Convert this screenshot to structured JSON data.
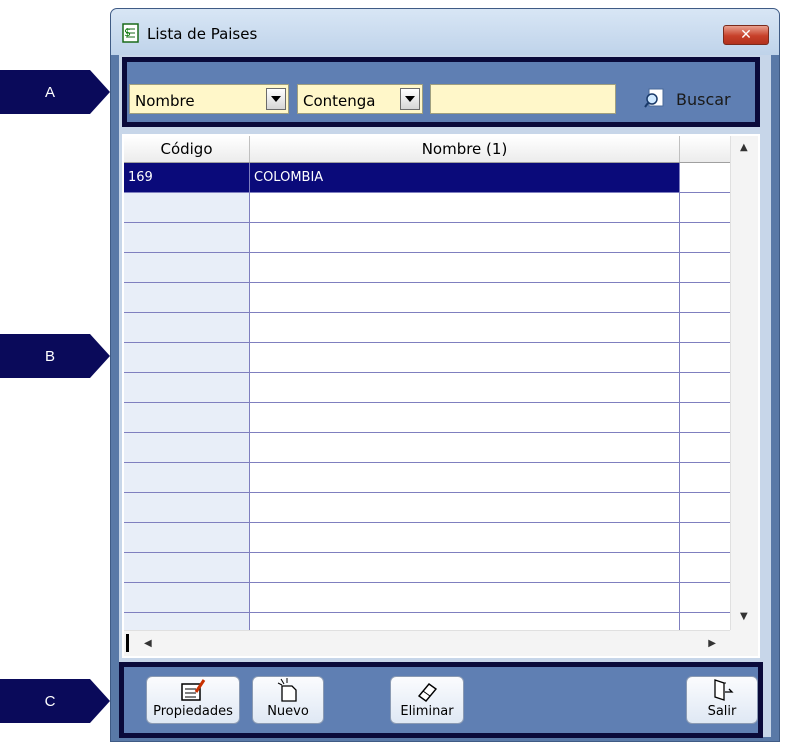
{
  "callouts": [
    {
      "label": "A"
    },
    {
      "label": "B"
    },
    {
      "label": "C"
    }
  ],
  "window": {
    "title": "Lista de Paises",
    "close_label": "✕"
  },
  "search": {
    "field_value": "Nombre",
    "operator_value": "Contenga",
    "text_value": "",
    "search_label": "Buscar"
  },
  "grid": {
    "columns": [
      "Código",
      "Nombre (1)"
    ],
    "rows": [
      {
        "codigo": "169",
        "nombre": "COLOMBIA",
        "selected": true
      }
    ],
    "empty_rows": 15
  },
  "footer": {
    "properties_label": "Propiedades",
    "new_label": "Nuevo",
    "delete_label": "Eliminar",
    "exit_label": "Salir"
  },
  "colors": {
    "callout": "#0a0a5a",
    "selection": "#0a0a7a",
    "frame": "#5979a7"
  }
}
